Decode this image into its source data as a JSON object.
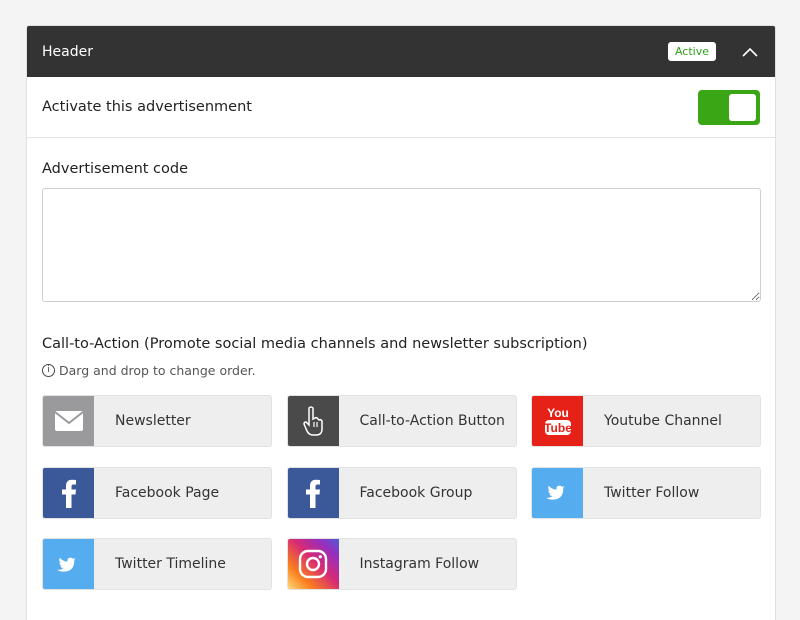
{
  "header": {
    "title": "Header",
    "status_badge": "Active",
    "status_color": "#2fa11a"
  },
  "activate": {
    "label": "Activate this advertisenment",
    "enabled": true,
    "toggle_color": "#3aa515"
  },
  "ad_code": {
    "label": "Advertisement code",
    "value": ""
  },
  "cta": {
    "title": "Call-to-Action (Promote social media channels and newsletter subscription)",
    "hint": "Darg and drop to change order.",
    "items": [
      {
        "label": "Newsletter",
        "icon": "envelope-icon",
        "color": "#9a9a9c"
      },
      {
        "label": "Call-to-Action Button",
        "icon": "pointer-hand-icon",
        "color": "#4a4a4a"
      },
      {
        "label": "Youtube Channel",
        "icon": "youtube-icon",
        "color": "#e62117"
      },
      {
        "label": "Facebook Page",
        "icon": "facebook-icon",
        "color": "#3b5998"
      },
      {
        "label": "Facebook Group",
        "icon": "facebook-icon",
        "color": "#3b5998"
      },
      {
        "label": "Twitter Follow",
        "icon": "twitter-icon",
        "color": "#55acee"
      },
      {
        "label": "Twitter Timeline",
        "icon": "twitter-icon",
        "color": "#55acee"
      },
      {
        "label": "Instagram Follow",
        "icon": "instagram-icon",
        "color": "#d62976"
      }
    ]
  }
}
